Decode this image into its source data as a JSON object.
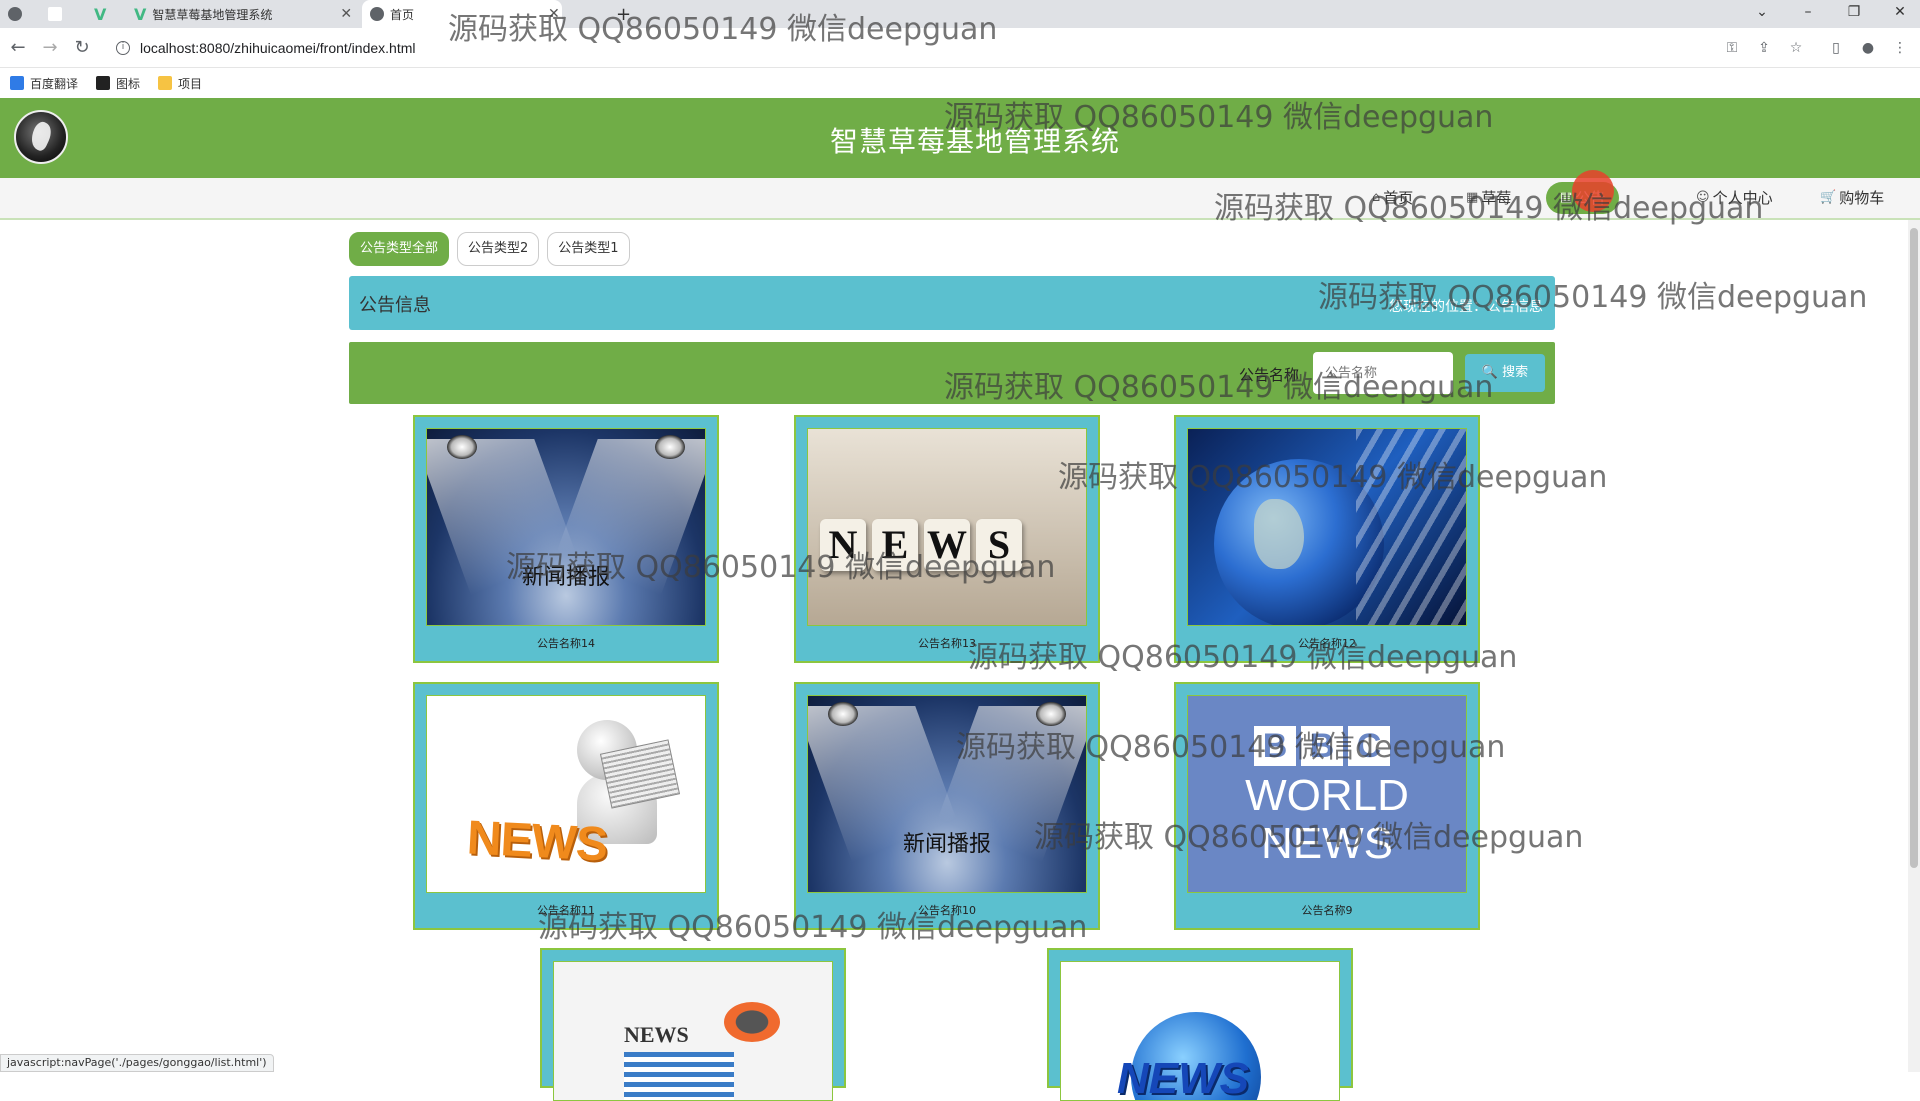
{
  "browser": {
    "tabs": [
      {
        "label": "智慧草莓基地管理系统",
        "active": false
      },
      {
        "label": "首页",
        "active": true
      }
    ],
    "new_tab": "+",
    "url": "localhost:8080/zhihuicaomei/front/index.html",
    "bookmarks": [
      "百度翻译",
      "图标",
      "项目"
    ],
    "status_text": "javascript:navPage('./pages/gonggao/list.html')"
  },
  "site": {
    "title": "智慧草莓基地管理系统",
    "nav": [
      {
        "label": "首页",
        "icon": "home-icon"
      },
      {
        "label": "草莓",
        "icon": "grid-icon"
      },
      {
        "label": "公告",
        "icon": "notice-icon",
        "active": true
      },
      {
        "label": "个人中心",
        "icon": "user-icon"
      },
      {
        "label": "购物车",
        "icon": "cart-icon"
      }
    ]
  },
  "filters": [
    "公告类型全部",
    "公告类型2",
    "公告类型1"
  ],
  "section": {
    "title": "公告信息",
    "location": "您现在的位置：公告信息"
  },
  "search": {
    "label": "公告名称",
    "placeholder": "公告名称",
    "button": "搜索"
  },
  "cards": [
    {
      "caption": "公告名称14",
      "image_text": "新闻播报"
    },
    {
      "caption": "公告名称13",
      "image_text": "NEWS"
    },
    {
      "caption": "公告名称12",
      "image_text": ""
    },
    {
      "caption": "公告名称11",
      "image_text": "NEWS"
    },
    {
      "caption": "公告名称10",
      "image_text": "新闻播报"
    },
    {
      "caption": "公告名称9",
      "image_text": "BBC WORLD NEWS"
    },
    {
      "caption": "",
      "image_text": "NEWS"
    },
    {
      "caption": "",
      "image_text": "NEWS"
    }
  ],
  "watermark": "源码获取 QQ86050149 微信deepguan",
  "colors": {
    "header_green": "#70ad47",
    "teal": "#5bc0cf",
    "card_border": "#8cc63f"
  }
}
